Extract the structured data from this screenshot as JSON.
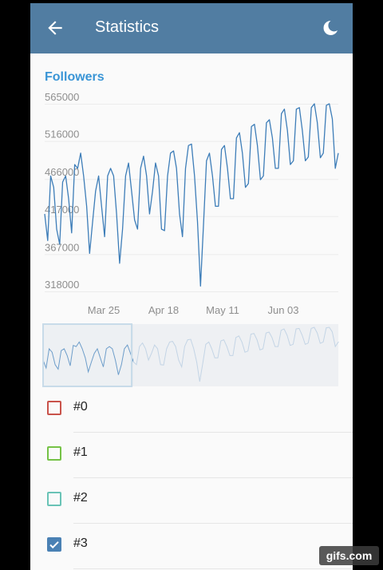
{
  "header": {
    "title": "Statistics",
    "back_icon": "arrow-left-icon",
    "theme_icon": "moon-icon",
    "bg_color": "#517da2"
  },
  "section": {
    "title": "Followers"
  },
  "chart_data": {
    "type": "line",
    "ylim": [
      318000,
      565000
    ],
    "y_ticks": [
      "565000",
      "516000",
      "466000",
      "417000",
      "367000",
      "318000"
    ],
    "x_ticks": [
      "Mar 25",
      "Apr 18",
      "May 11",
      "Jun 03"
    ],
    "grid": true,
    "series": [
      {
        "label": "#3",
        "color": "#3d7db8",
        "values": [
          420000,
          385000,
          470000,
          455000,
          400000,
          380000,
          462000,
          470000,
          440000,
          395000,
          485000,
          480000,
          500000,
          470000,
          430000,
          368000,
          410000,
          450000,
          470000,
          430000,
          390000,
          470000,
          480000,
          470000,
          420000,
          355000,
          400000,
          470000,
          487000,
          450000,
          412000,
          400000,
          480000,
          496000,
          470000,
          420000,
          450000,
          487000,
          470000,
          400000,
          398000,
          470000,
          500000,
          503000,
          480000,
          420000,
          390000,
          480000,
          510000,
          512000,
          470000,
          410000,
          325000,
          405000,
          490000,
          500000,
          470000,
          430000,
          430000,
          505000,
          510000,
          480000,
          440000,
          440000,
          520000,
          527000,
          500000,
          455000,
          460000,
          535000,
          538000,
          510000,
          465000,
          470000,
          540000,
          544000,
          520000,
          480000,
          480000,
          552000,
          558000,
          530000,
          485000,
          490000,
          558000,
          560000,
          530000,
          490000,
          495000,
          560000,
          565000,
          540000,
          494000,
          500000,
          563000,
          565000,
          545000,
          480000,
          500000
        ]
      }
    ],
    "preview_range": [
      0.0,
      0.3
    ]
  },
  "legend": [
    {
      "label": "#0",
      "color": "#c9524a",
      "checked": false
    },
    {
      "label": "#1",
      "color": "#75c246",
      "checked": false
    },
    {
      "label": "#2",
      "color": "#69c3b6",
      "checked": false
    },
    {
      "label": "#3",
      "color": "#4a81b4",
      "checked": true
    }
  ],
  "watermark": "gifs.com"
}
